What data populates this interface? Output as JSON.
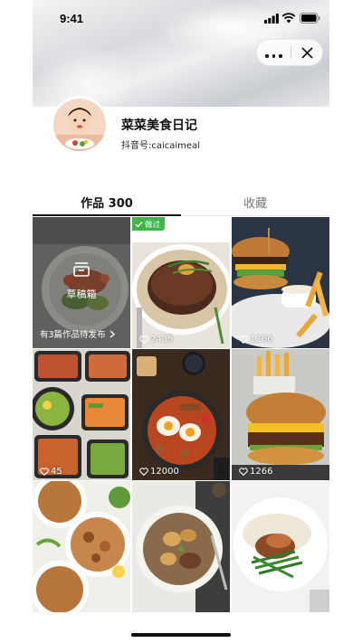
{
  "status_bar": {
    "time": "9:41"
  },
  "capsule": {
    "more_icon": "more-dots-icon",
    "close_icon": "close-x-icon"
  },
  "profile": {
    "name": "菜菜美食日记",
    "id_text": "抖音号:caicaimeal"
  },
  "tabs": [
    {
      "label": "作品 300",
      "active": true
    },
    {
      "label": "收藏",
      "active": false
    }
  ],
  "grid": {
    "draft": {
      "title": "草稿箱",
      "note": "有3篇作品待发布"
    },
    "items": [
      {
        "kind": "draft",
        "photo": "grilled chicken salad plate"
      },
      {
        "kind": "post",
        "photo": "steak with herbs on board",
        "badge": "做过",
        "likes": "2435"
      },
      {
        "kind": "post",
        "photo": "burger with fries and dip",
        "likes": "1266"
      },
      {
        "kind": "post",
        "photo": "meal prep containers",
        "likes": "45"
      },
      {
        "kind": "post",
        "photo": "english breakfast pan",
        "likes": "12000"
      },
      {
        "kind": "post",
        "photo": "cheeseburger with fries",
        "likes": "1266"
      },
      {
        "kind": "post",
        "photo": "roasted chicken bites",
        "likes": ""
      },
      {
        "kind": "post",
        "photo": "roasted potatoes with meat",
        "likes": ""
      },
      {
        "kind": "post",
        "photo": "steak with green beans",
        "likes": ""
      }
    ]
  },
  "colors": {
    "badge_green": "#3fb54a",
    "text_primary": "#111111",
    "text_secondary": "#777777"
  }
}
